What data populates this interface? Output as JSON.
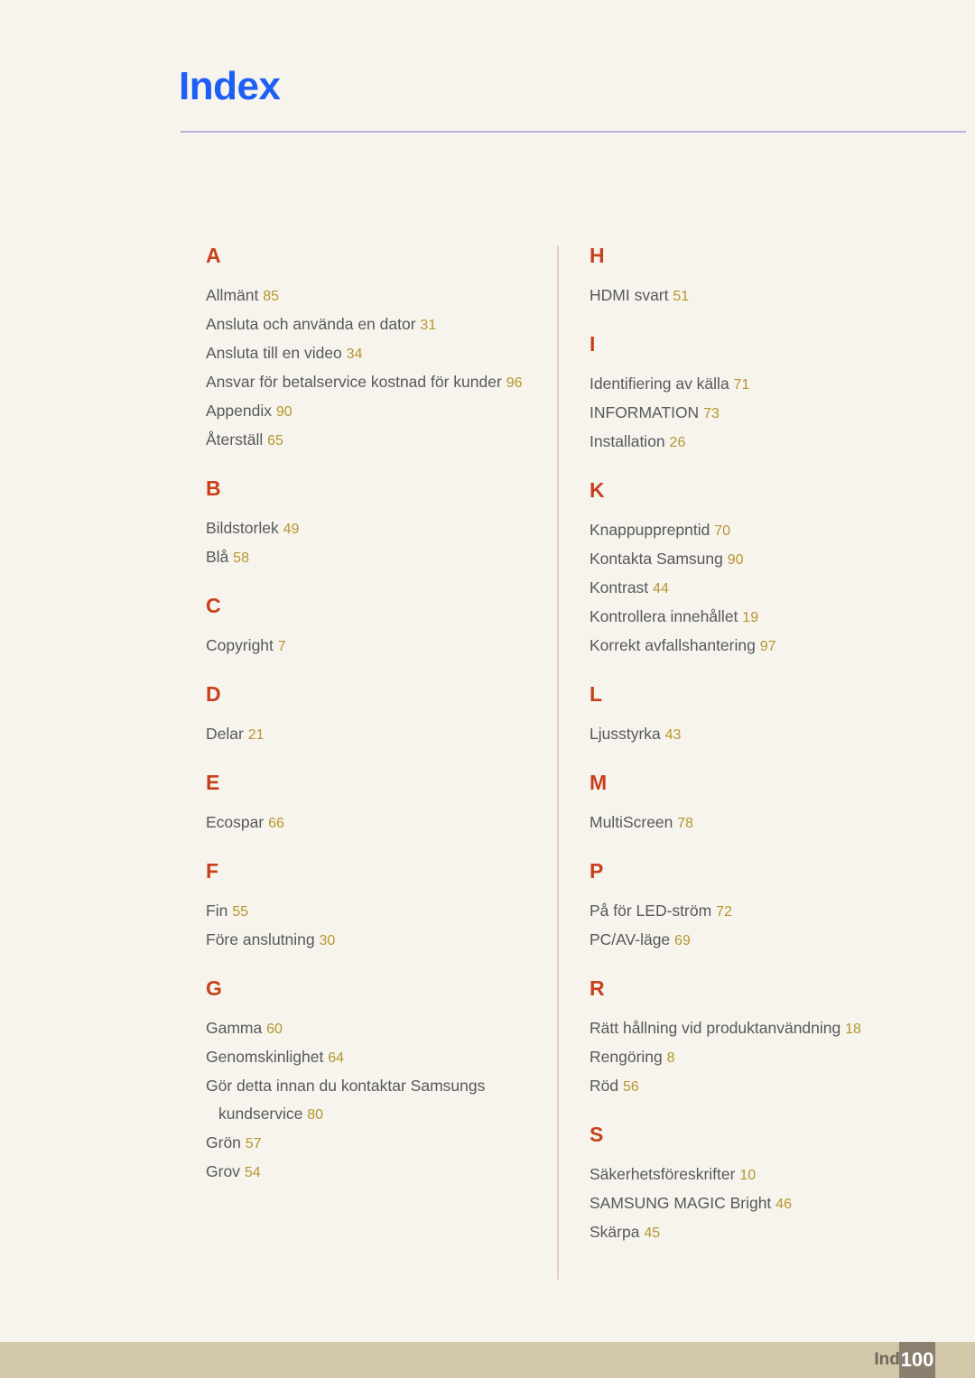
{
  "header": {
    "title": "Index",
    "title_color": "#1d5ff5",
    "rule_color": "#b9b4dc"
  },
  "theme": {
    "background": "#f6f4ed",
    "letter_heading_color": "#c8401a",
    "entry_text_color": "#58585a",
    "page_number_color": "#b6962d",
    "divider_color": "#e8cfc6",
    "footer_band_color": "#d2c7a9",
    "footer_box_color": "#8b8070"
  },
  "columns": {
    "left": [
      {
        "letter": "A",
        "entries": [
          {
            "title": "Allmänt",
            "page": "85"
          },
          {
            "title": "Ansluta och använda en dator",
            "page": "31"
          },
          {
            "title": "Ansluta till en video",
            "page": "34"
          },
          {
            "title": "Ansvar för betalservice kostnad för kunder",
            "page": "96"
          },
          {
            "title": "Appendix",
            "page": "90"
          },
          {
            "title": "Återställ",
            "page": "65"
          }
        ]
      },
      {
        "letter": "B",
        "entries": [
          {
            "title": "Bildstorlek",
            "page": "49"
          },
          {
            "title": "Blå",
            "page": "58"
          }
        ]
      },
      {
        "letter": "C",
        "entries": [
          {
            "title": "Copyright",
            "page": "7"
          }
        ]
      },
      {
        "letter": "D",
        "entries": [
          {
            "title": "Delar",
            "page": "21"
          }
        ]
      },
      {
        "letter": "E",
        "entries": [
          {
            "title": "Ecospar",
            "page": "66"
          }
        ]
      },
      {
        "letter": "F",
        "entries": [
          {
            "title": "Fin",
            "page": "55"
          },
          {
            "title": "Före anslutning",
            "page": "30"
          }
        ]
      },
      {
        "letter": "G",
        "entries": [
          {
            "title": "Gamma",
            "page": "60"
          },
          {
            "title": "Genomskinlighet",
            "page": "64"
          },
          {
            "title": "Gör detta innan du kontaktar Samsungs kundservice",
            "page": "80"
          },
          {
            "title": "Grön",
            "page": "57"
          },
          {
            "title": "Grov",
            "page": "54"
          }
        ]
      }
    ],
    "right": [
      {
        "letter": "H",
        "entries": [
          {
            "title": "HDMI svart",
            "page": "51"
          }
        ]
      },
      {
        "letter": "I",
        "entries": [
          {
            "title": "Identifiering av källa",
            "page": "71"
          },
          {
            "title": "INFORMATION",
            "page": "73"
          },
          {
            "title": "Installation",
            "page": "26"
          }
        ]
      },
      {
        "letter": "K",
        "entries": [
          {
            "title": "Knappupprepntid",
            "page": "70"
          },
          {
            "title": "Kontakta Samsung",
            "page": "90"
          },
          {
            "title": "Kontrast",
            "page": "44"
          },
          {
            "title": "Kontrollera innehållet",
            "page": "19"
          },
          {
            "title": "Korrekt avfallshantering",
            "page": "97"
          }
        ]
      },
      {
        "letter": "L",
        "entries": [
          {
            "title": "Ljusstyrka",
            "page": "43"
          }
        ]
      },
      {
        "letter": "M",
        "entries": [
          {
            "title": "MultiScreen",
            "page": "78"
          }
        ]
      },
      {
        "letter": "P",
        "entries": [
          {
            "title": "På för LED-ström",
            "page": "72"
          },
          {
            "title": "PC/AV-läge",
            "page": "69"
          }
        ]
      },
      {
        "letter": "R",
        "entries": [
          {
            "title": "Rätt hållning vid produktanvändning",
            "page": "18"
          },
          {
            "title": "Rengöring",
            "page": "8"
          },
          {
            "title": "Röd",
            "page": "56"
          }
        ]
      },
      {
        "letter": "S",
        "entries": [
          {
            "title": "Säkerhetsföreskrifter",
            "page": "10"
          },
          {
            "title": "SAMSUNG MAGIC Bright",
            "page": "46"
          },
          {
            "title": "Skärpa",
            "page": "45"
          }
        ]
      }
    ]
  },
  "footer": {
    "label": "Index",
    "page_number": "100"
  }
}
